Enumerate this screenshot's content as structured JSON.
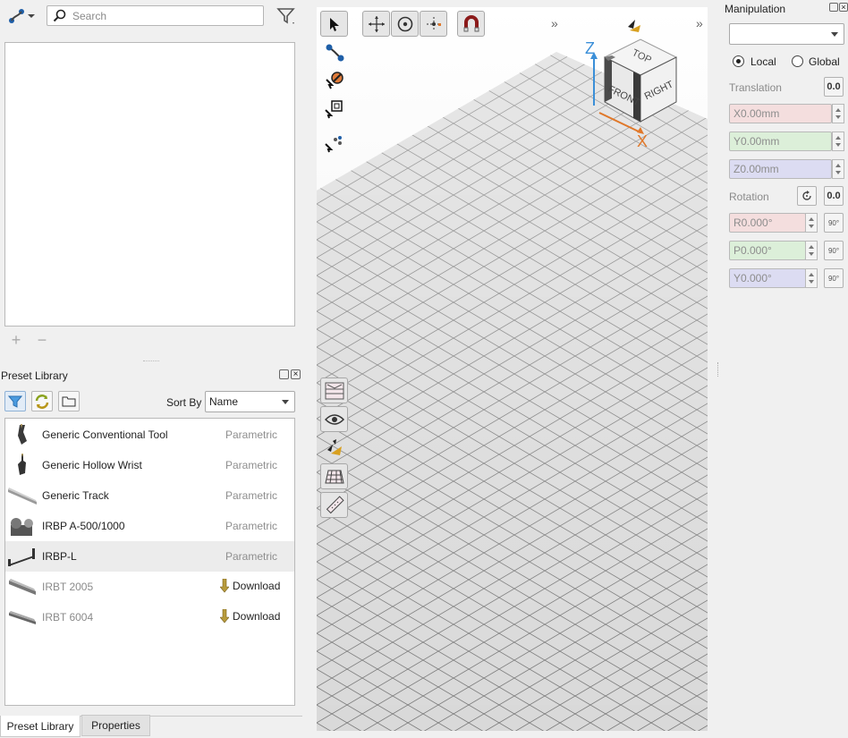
{
  "toolbar": {
    "search_placeholder": "Search",
    "icons": [
      "connection-icon",
      "search-icon",
      "filter-icon"
    ]
  },
  "tree_actions": {
    "add": "+",
    "remove": "−"
  },
  "preset_library": {
    "title": "Preset Library",
    "sort_label": "Sort By",
    "sort_value": "Name",
    "items": [
      {
        "name": "Generic Conventional Tool",
        "kind": "Parametric",
        "download": false
      },
      {
        "name": "Generic Hollow Wrist",
        "kind": "Parametric",
        "download": false
      },
      {
        "name": "Generic Track",
        "kind": "Parametric",
        "download": false
      },
      {
        "name": "IRBP A-500/1000",
        "kind": "Parametric",
        "download": false
      },
      {
        "name": "IRBP-L",
        "kind": "Parametric",
        "download": false,
        "selected": true
      },
      {
        "name": "IRBT 2005",
        "kind": "Download",
        "download": true
      },
      {
        "name": "IRBT 6004",
        "kind": "Download",
        "download": true
      }
    ]
  },
  "bottom_tabs": [
    {
      "label": "Preset Library",
      "active": true
    },
    {
      "label": "Properties",
      "active": false
    }
  ],
  "viewport": {
    "cube": {
      "top": "TOP",
      "front": "FRONT",
      "right": "RIGHT"
    },
    "axes": {
      "z": "Z",
      "x": "X"
    },
    "expand_glyph": "»"
  },
  "manipulation": {
    "title": "Manipulation",
    "dropdown_value": "",
    "frame_options": [
      {
        "label": "Local",
        "selected": true
      },
      {
        "label": "Global",
        "selected": false
      }
    ],
    "translation_label": "Translation",
    "reset_label": "0.0",
    "translation": [
      {
        "placeholder": "X0.00mm",
        "color": "#f4dede"
      },
      {
        "placeholder": "Y0.00mm",
        "color": "#dcefd9"
      },
      {
        "placeholder": "Z0.00mm",
        "color": "#dcdcf2"
      }
    ],
    "rotation_label": "Rotation",
    "rotation": [
      {
        "placeholder": "R0.000°",
        "color": "#f4dede"
      },
      {
        "placeholder": "P0.000°",
        "color": "#dcefd9"
      },
      {
        "placeholder": "Y0.000°",
        "color": "#dcdcf2"
      }
    ],
    "rotate_90_label": "90°"
  }
}
